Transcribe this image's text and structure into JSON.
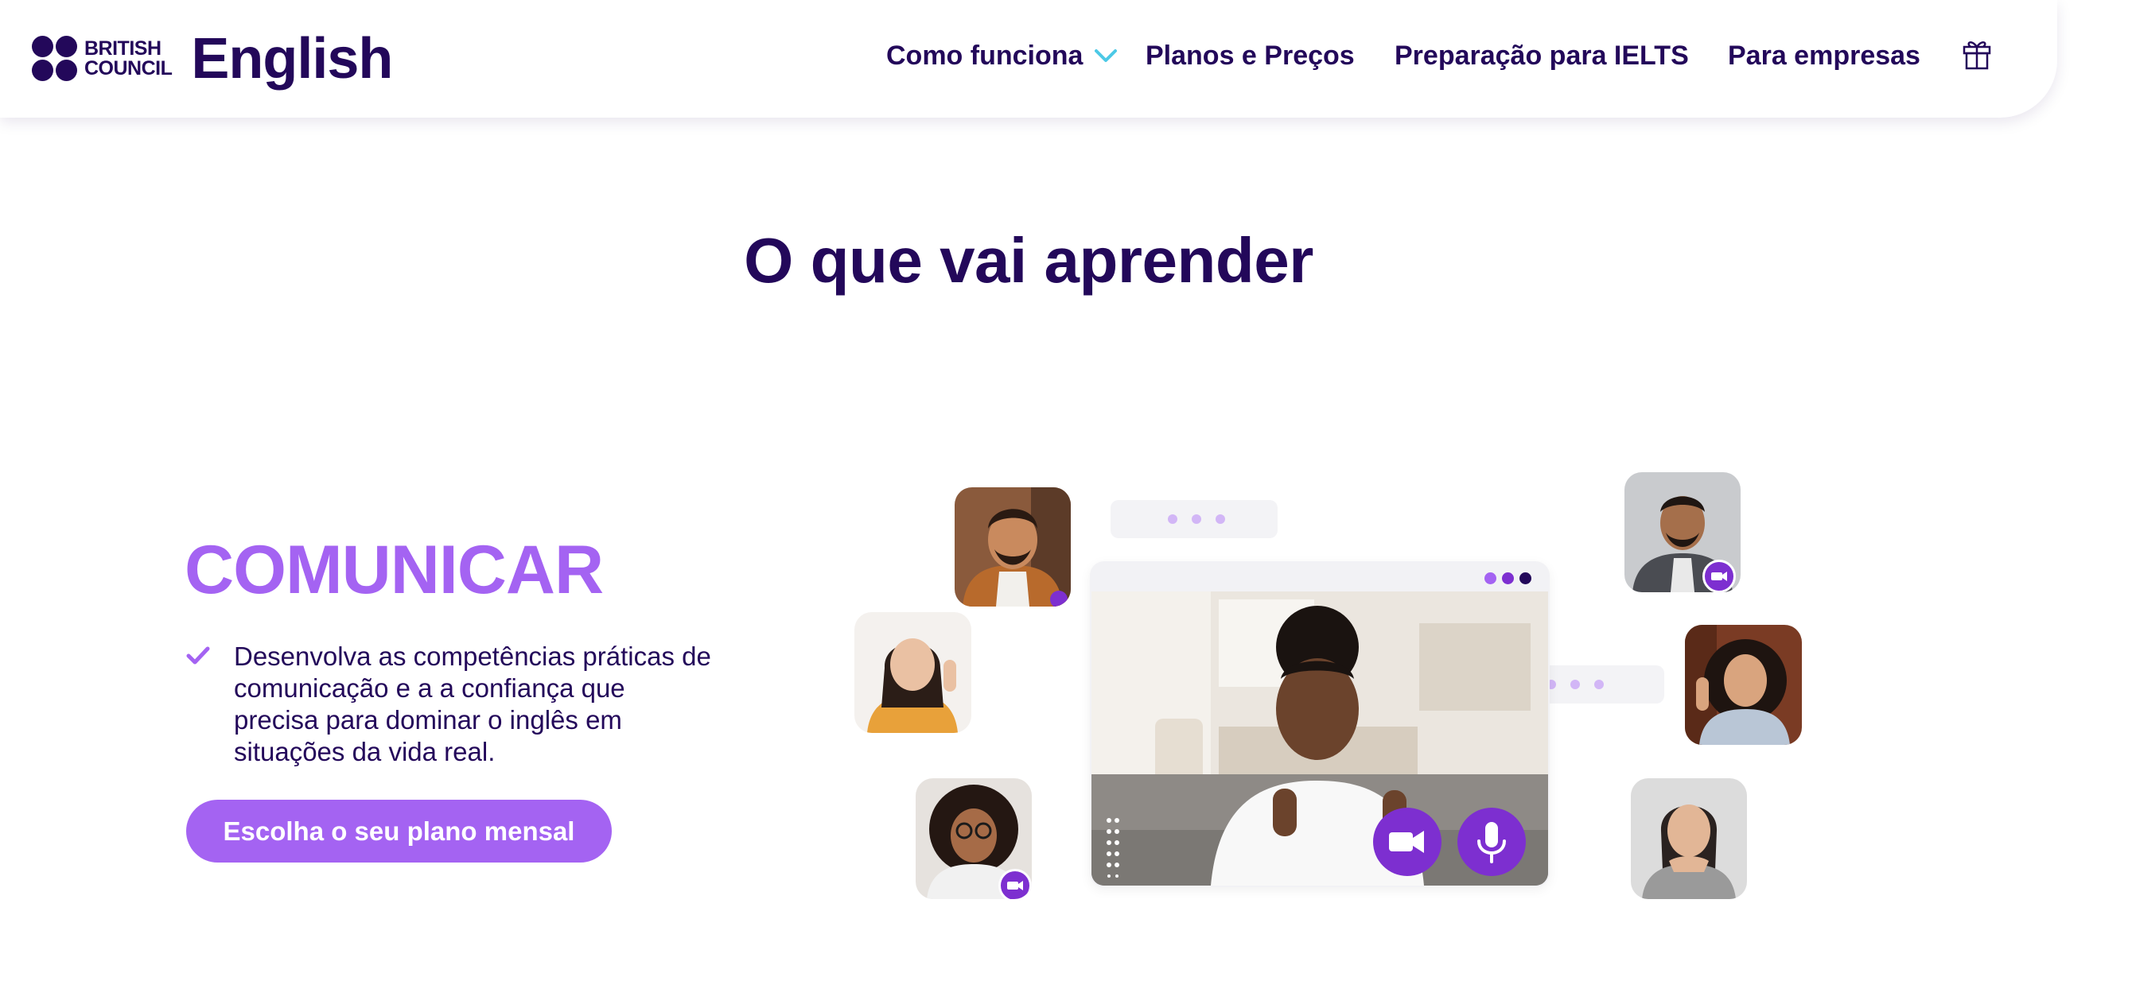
{
  "header": {
    "logo": {
      "line1": "BRITISH",
      "line2": "COUNCIL",
      "product": "English"
    },
    "nav": [
      {
        "label": "Como funciona",
        "has_dropdown": true
      },
      {
        "label": "Planos e Preços"
      },
      {
        "label": "Preparação para IELTS"
      },
      {
        "label": "Para empresas"
      }
    ],
    "gift_icon": "gift-icon"
  },
  "headline": "O que vai aprender",
  "feature": {
    "title": "COMUNICAR",
    "bullet": "Desenvolva as competências práticas de comunicação e a a confiança que precisa para dominar o inglês em situações da vida real.",
    "cta_label": "Escolha o seu plano mensal"
  },
  "colors": {
    "navy": "#23085a",
    "accent_purple": "#a463f2",
    "cyan_chevron": "#4cc9e6",
    "control_purple": "#7d2fd0"
  },
  "illustration": {
    "icons": [
      "video-camera-icon",
      "microphone-icon",
      "typing-dots-icon"
    ]
  }
}
